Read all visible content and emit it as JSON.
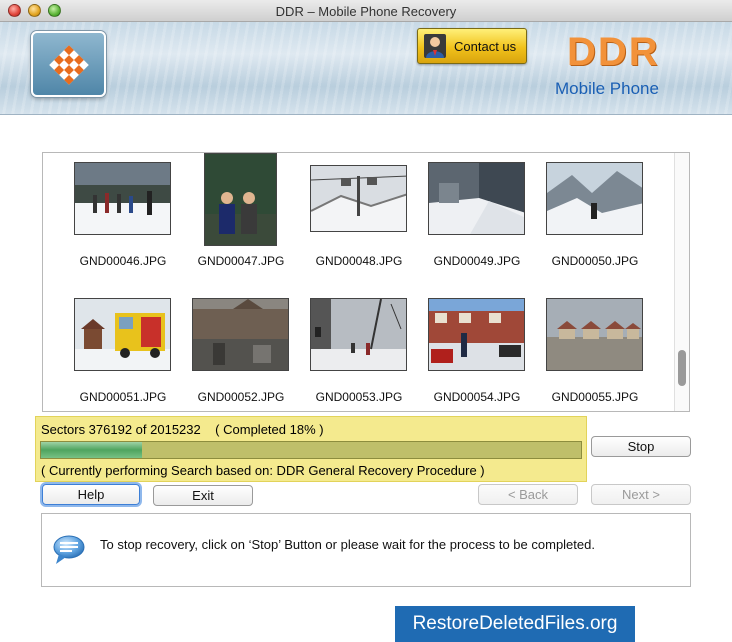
{
  "window": {
    "title": "DDR – Mobile Phone Recovery"
  },
  "header": {
    "contact_label": "Contact us",
    "brand": "DDR",
    "product": "Mobile Phone"
  },
  "thumbnails": [
    {
      "name": "GND00046.JPG"
    },
    {
      "name": "GND00047.JPG"
    },
    {
      "name": "GND00048.JPG"
    },
    {
      "name": "GND00049.JPG"
    },
    {
      "name": "GND00050.JPG"
    },
    {
      "name": "GND00051.JPG"
    },
    {
      "name": "GND00052.JPG"
    },
    {
      "name": "GND00053.JPG"
    },
    {
      "name": "GND00054.JPG"
    },
    {
      "name": "GND00055.JPG"
    }
  ],
  "progress": {
    "sectors_text": "Sectors 376192 of 2015232    ( Completed 18% )",
    "fraction": 0.187,
    "procedure_text": "( Currently performing Search based on: DDR General Recovery Procedure )"
  },
  "buttons": {
    "stop": "Stop",
    "help": "Help",
    "exit": "Exit",
    "back": "< Back",
    "next": "Next >"
  },
  "info": {
    "message": "To stop recovery, click on ‘Stop’ Button or please wait for the process to be completed."
  },
  "footer": {
    "site": "RestoreDeletedFiles.org"
  },
  "colors": {
    "progress_panel": "#f4ea8e",
    "progress_fill": "#4fa45f",
    "brand_orange": "#f2923a",
    "product_blue": "#1a5fb4",
    "footer_blue": "#1f6bb3"
  }
}
